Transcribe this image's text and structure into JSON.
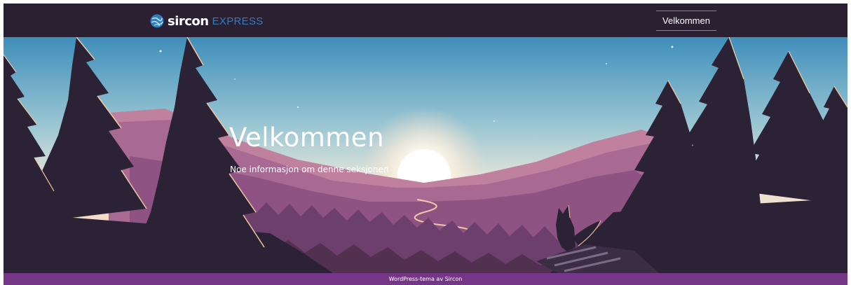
{
  "header": {
    "logo": {
      "word": "sircon",
      "sub": "EXPRESS",
      "icon": "globe-logo-icon"
    },
    "nav": [
      {
        "label": "Velkommen"
      }
    ]
  },
  "hero": {
    "title": "Velkommen",
    "subtitle": "Noe informasjon om denne seksjonen"
  },
  "footer": {
    "text": "WordPress-tema av Sircon"
  },
  "colors": {
    "header_bg": "#2a2032",
    "footer_bg": "#763687",
    "logo_accent": "#2f7fbf",
    "sky_top": "#3e8cb8",
    "sky_horizon": "#fbf3df",
    "tree_silhouette": "#2c2236"
  }
}
